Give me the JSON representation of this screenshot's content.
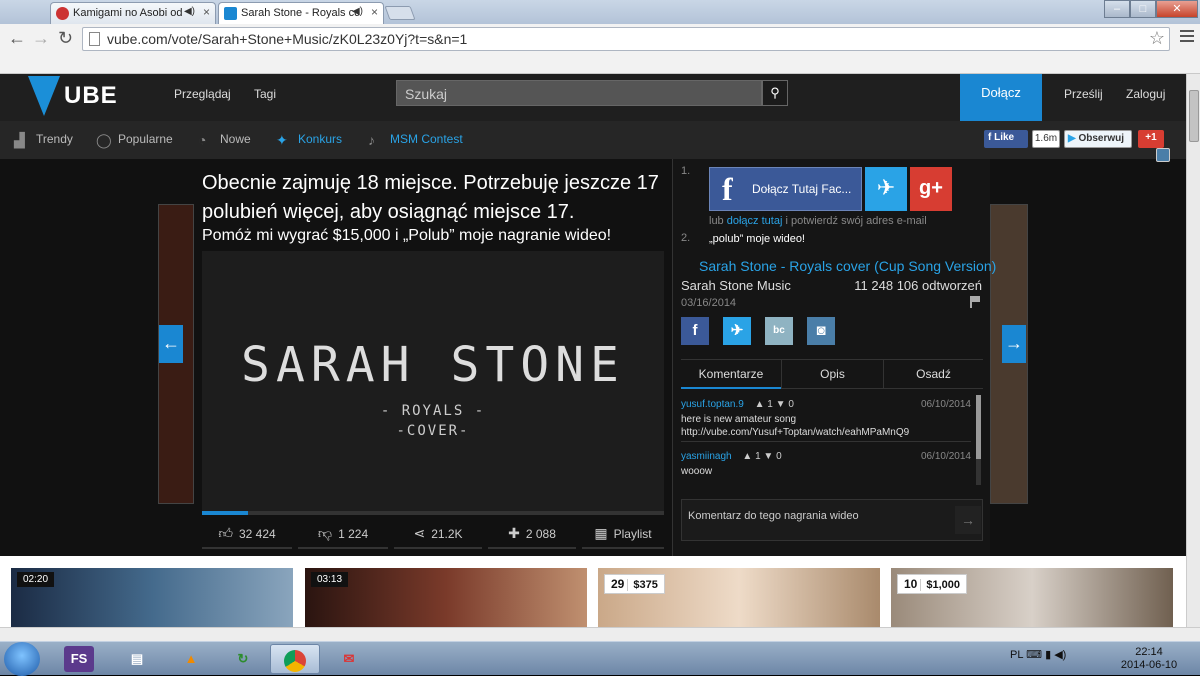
{
  "browser": {
    "tabs": [
      {
        "title": "Kamigami no Asobi od",
        "active": false
      },
      {
        "title": "Sarah Stone - Royals cc",
        "active": true
      }
    ],
    "url": "vube.com/vote/Sarah+Stone+Music/zK0L23z0Yj?t=s&n=1"
  },
  "header": {
    "logo": "UBE",
    "nav": [
      "Przeglądaj",
      "Tagi"
    ],
    "search_placeholder": "Szukaj",
    "join": "Dołącz",
    "upload": "Prześlij",
    "login": "Zaloguj"
  },
  "subnav": {
    "items": [
      "Trendy",
      "Popularne",
      "Nowe",
      "Konkurs",
      "MSM Contest"
    ],
    "like_label": "Like",
    "like_count": "1.6m",
    "follow_label": "Obserwuj",
    "gplus_label": "+1"
  },
  "status": {
    "line1": "Obecnie zajmuję 18 miejsce. Potrzebuję jeszcze 17 polubień więcej, aby osiągnąć miejsce 17.",
    "line2": "Pomóż mi wygrać $15,000 i „Polub” moje nagranie wideo!"
  },
  "video": {
    "title_art": "SARAH STONE",
    "sub1": "- ROYALS -",
    "sub2": "-COVER-",
    "progress": 0.1
  },
  "actions": {
    "likes": "32 424",
    "dislikes": "1 224",
    "shares": "21.2K",
    "adds": "2 088",
    "playlist": "Playlist"
  },
  "signup": {
    "step1": "1.",
    "step2": "2.",
    "fb_label": "Dołącz Tutaj Fac...",
    "or_prefix": "lub ",
    "or_link": "dołącz tutaj",
    "or_suffix": " i potwierdź swój adres e-mail",
    "step2_text": "„polub” moje wideo!"
  },
  "details": {
    "title": "Sarah Stone - Royals cover (Cup Song Version)",
    "channel": "Sarah Stone Music",
    "views": "11 248 106 odtworzeń",
    "date": "03/16/2014"
  },
  "tabs": [
    "Komentarze",
    "Opis",
    "Osadź"
  ],
  "comments": [
    {
      "user": "yusuf.toptan.9",
      "up": "1",
      "down": "0",
      "date": "06/10/2014",
      "text": "here is new amateur song http://vube.com/Yusuf+Toptan/watch/eahMPaMnQ9"
    },
    {
      "user": "yasmiinagh",
      "up": "1",
      "down": "0",
      "date": "06/10/2014",
      "text": "wooow"
    }
  ],
  "comment_placeholder": "Komentarz do tego nagrania wideo",
  "bottom_thumbs": [
    {
      "badge": "02:20",
      "type": "duration"
    },
    {
      "badge": "03:13",
      "type": "duration"
    },
    {
      "rank": "29",
      "prize": "$375",
      "type": "rank"
    },
    {
      "rank": "10",
      "prize": "$1,000",
      "type": "rank"
    }
  ],
  "taskbar": {
    "apps": [
      "FS"
    ],
    "lang": "PL",
    "time": "22:14",
    "date": "2014-06-10"
  },
  "colors": {
    "accent": "#1a87d2",
    "facebook": "#3b5998",
    "twitter": "#2aa3e6",
    "gplus": "#d73d32"
  }
}
